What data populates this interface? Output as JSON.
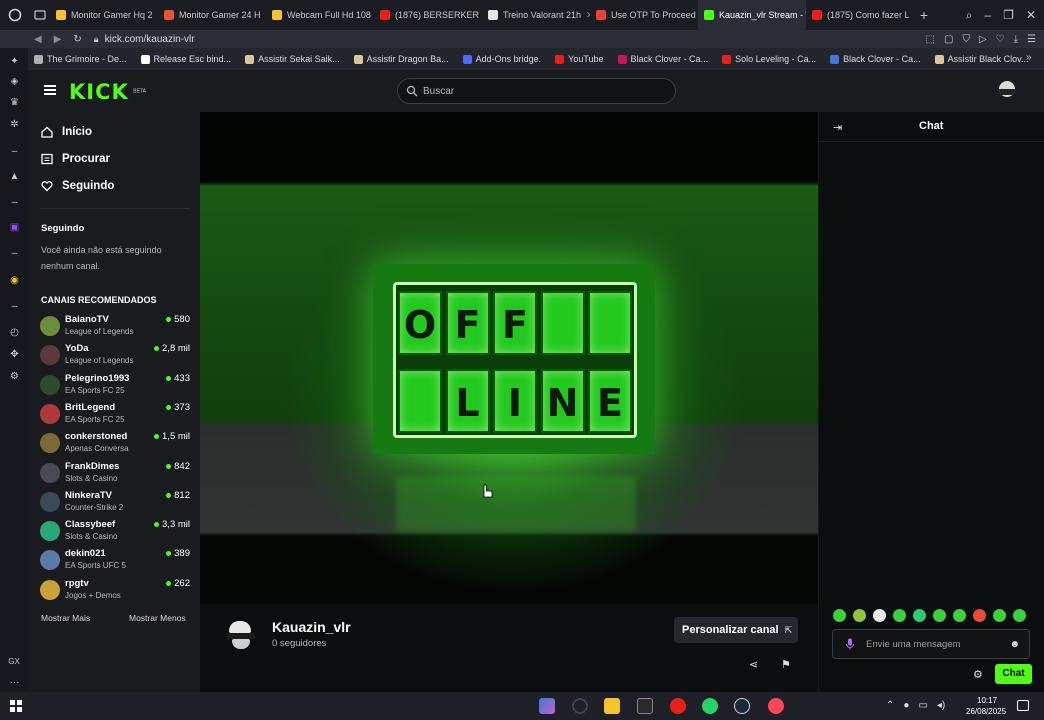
{
  "browser": {
    "tabs": [
      {
        "label": "Monitor Gamer Hq 2",
        "color": "#f4c430"
      },
      {
        "label": "Monitor Gamer 24 H",
        "color": "#e2572e"
      },
      {
        "label": "Webcam Full Hd 108",
        "color": "#f4c430"
      },
      {
        "label": "(1876) BERSERKER",
        "color": "#e62117"
      },
      {
        "label": "Treino Valorant 21h",
        "color": "#e6e6e6"
      },
      {
        "label": "Use OTP To Proceed",
        "color": "#ea4335"
      },
      {
        "label": "Kauazin_vlr Stream - Wat",
        "color": "#53fc18"
      },
      {
        "label": "(1875) Como fazer L",
        "color": "#e62117"
      }
    ],
    "url": "kick.com/kauazin-vlr",
    "bookmarks": [
      {
        "label": "The Grimoire - De...",
        "color": "#b0b0b0"
      },
      {
        "label": "Release Esc bind...",
        "color": "#ffffff"
      },
      {
        "label": "Assistir Sekai Saik...",
        "color": "#d9c7a0"
      },
      {
        "label": "Assistir Dragon Ba...",
        "color": "#d9c7a0"
      },
      {
        "label": "Add-Ons bridge.",
        "color": "#4a6cf7"
      },
      {
        "label": "YouTube",
        "color": "#e62117"
      },
      {
        "label": "Black Clover - Ca...",
        "color": "#c2185b"
      },
      {
        "label": "Solo Leveling - Ca...",
        "color": "#e62117"
      },
      {
        "label": "Black Clover - Ca...",
        "color": "#3b7bd8"
      },
      {
        "label": "Assistir Black Clov...",
        "color": "#d9c7a0"
      }
    ],
    "gx_label": "GX",
    "gx_more": "···"
  },
  "header": {
    "logo": "KICK",
    "logo_badge": "BETA",
    "search_placeholder": "Buscar"
  },
  "nav": {
    "items": [
      {
        "label": "Início",
        "icon": "home-icon"
      },
      {
        "label": "Procurar",
        "icon": "browse-icon"
      },
      {
        "label": "Seguindo",
        "icon": "heart-icon"
      }
    ],
    "following_title": "Seguindo",
    "following_empty": "Você ainda não está seguindo nenhum canal.",
    "recommended_title": "CANAIS RECOMENDADOS",
    "channels": [
      {
        "name": "BaianoTV",
        "category": "League of Legends",
        "viewers": "580",
        "color": "#6b8e3a"
      },
      {
        "name": "YoDa",
        "category": "League of Legends",
        "viewers": "2,8 mil",
        "color": "#5a3a3a"
      },
      {
        "name": "Pelegrino1993",
        "category": "EA Sports FC 25",
        "viewers": "433",
        "color": "#2f4a2f"
      },
      {
        "name": "BritLegend",
        "category": "EA Sports FC 25",
        "viewers": "373",
        "color": "#b03a3a"
      },
      {
        "name": "conkerstoned",
        "category": "Apenas Conversa",
        "viewers": "1,5 mil",
        "color": "#7a6a3a"
      },
      {
        "name": "FrankDimes",
        "category": "Slots & Casino",
        "viewers": "842",
        "color": "#4a4a55"
      },
      {
        "name": "NinkeraTV",
        "category": "Counter-Strike 2",
        "viewers": "812",
        "color": "#3a4a5a"
      },
      {
        "name": "Classybeef",
        "category": "Slots & Casino",
        "viewers": "3,3 mil",
        "color": "#2aa87a"
      },
      {
        "name": "dekin021",
        "category": "EA Sports UFC 5",
        "viewers": "389",
        "color": "#5a7aa8"
      },
      {
        "name": "rpgtv",
        "category": "Jogos + Demos",
        "viewers": "262",
        "color": "#c9a23a"
      }
    ],
    "show_more": "Mostrar Mais",
    "show_less": "Mostrar Menos"
  },
  "player": {
    "row1": [
      "O",
      "F",
      "F",
      "",
      ""
    ],
    "row2": [
      "",
      "L",
      "I",
      "N",
      "E"
    ]
  },
  "channel": {
    "name": "Kauazin_vlr",
    "followers": "0 seguidores",
    "customize_label": "Personalizar canal"
  },
  "chat": {
    "title": "Chat",
    "input_placeholder": "Envie uma mensagem",
    "send_label": "Chat",
    "emotes": [
      "#3ecf3e",
      "#8dc63f",
      "#e7e7e7",
      "#3ecf3e",
      "#2ecc71",
      "#3ecf3e",
      "#3ecf3e",
      "#e74c3c",
      "#3ecf3e",
      "#3ecf3e"
    ]
  },
  "taskbar": {
    "time": "10:17",
    "date": "26/08/2025"
  },
  "colors": {
    "kick_green": "#53fc18",
    "panel": "#191b1f",
    "background": "#0b0e0f"
  }
}
